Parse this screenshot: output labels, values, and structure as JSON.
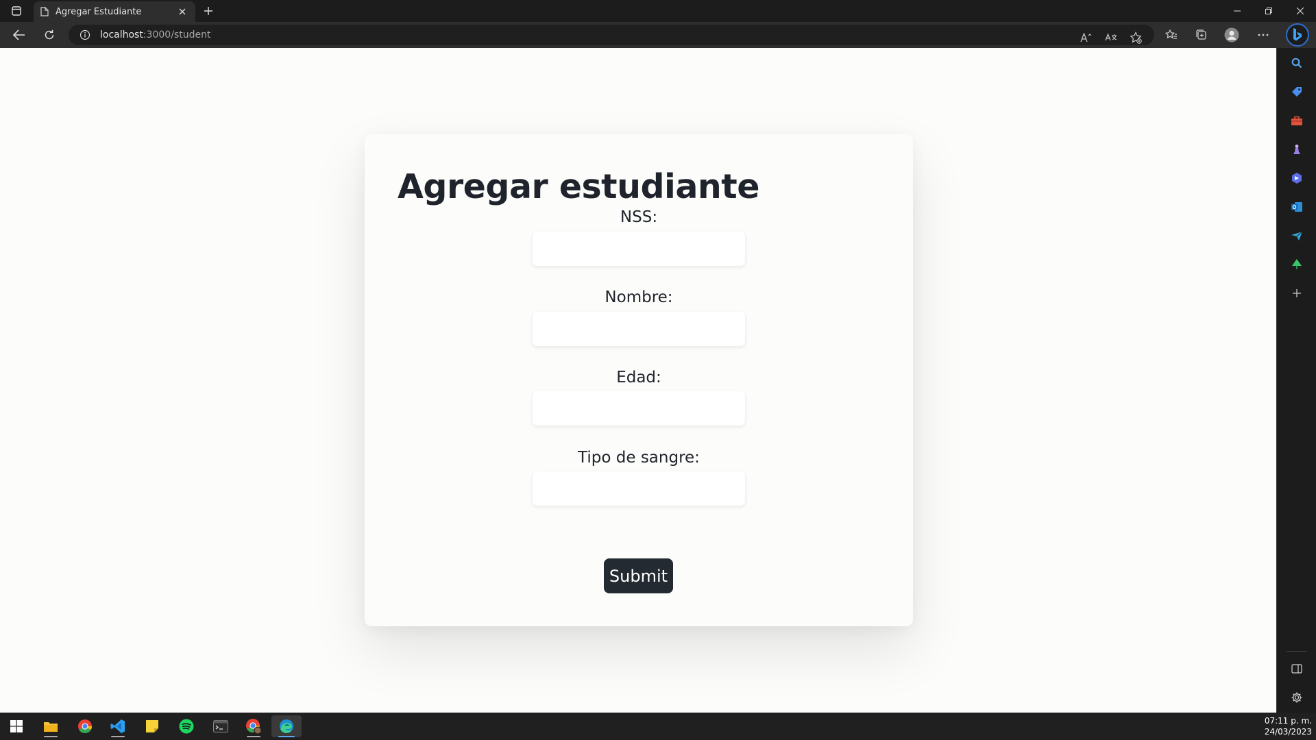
{
  "browser": {
    "tab_title": "Agregar Estudiante",
    "url_host": "localhost",
    "url_path": ":3000/student"
  },
  "form": {
    "heading": "Agregar estudiante",
    "fields": [
      {
        "label": "NSS:",
        "value": ""
      },
      {
        "label": "Nombre:",
        "value": ""
      },
      {
        "label": "Edad:",
        "value": ""
      },
      {
        "label": "Tipo de sangre:",
        "value": ""
      }
    ],
    "submit_label": "Submit"
  },
  "taskbar": {
    "time": "07:11 p. m.",
    "date": "24/03/2023"
  },
  "colors": {
    "page_background": "#fcfcfa",
    "text_dark": "#1f232b",
    "button_background": "#242a31"
  },
  "icons": {
    "sidebar": [
      "search-icon",
      "tag-icon",
      "toolbox-icon",
      "chess-icon",
      "office-icon",
      "outlook-icon",
      "send-icon",
      "tree-icon",
      "add-icon",
      "sidebar-layout-icon",
      "settings-icon"
    ]
  }
}
